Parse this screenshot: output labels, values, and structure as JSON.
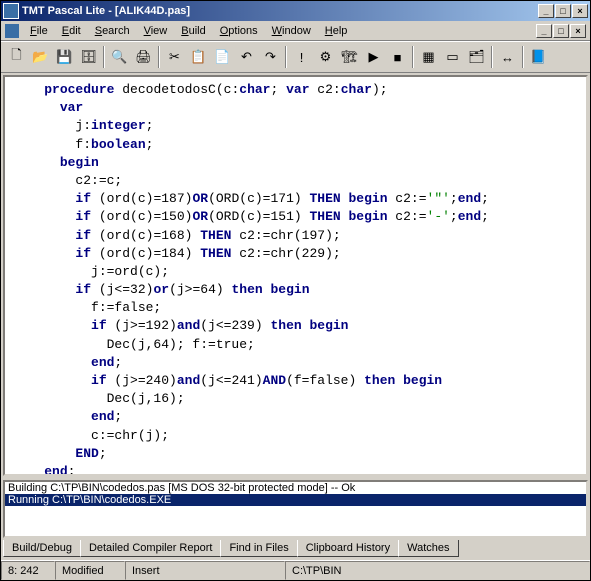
{
  "title": "TMT Pascal Lite - [ALIK44D.pas]",
  "menu": [
    "File",
    "Edit",
    "Search",
    "View",
    "Build",
    "Options",
    "Window",
    "Help"
  ],
  "winbtns": {
    "min": "_",
    "max": "□",
    "close": "×"
  },
  "toolbar_names": [
    "new-file-icon",
    "open-file-icon",
    "save-icon",
    "save-all-icon",
    "print-preview-icon",
    "print-icon",
    "cut-icon",
    "copy-icon",
    "paste-icon",
    "undo-icon",
    "redo-icon",
    "exclaim-icon",
    "compile-icon",
    "build-icon",
    "run-icon",
    "stop-icon",
    "tile-icon",
    "cascade-icon",
    "close-all-icon",
    "toggle-icon",
    "help-icon"
  ],
  "code": [
    [
      [
        "kw",
        "procedure"
      ],
      [
        "",
        ". decodetodosC(c:"
      ],
      [
        "kw",
        "char"
      ],
      [
        "",
        "; "
      ],
      [
        "kw",
        "var"
      ],
      [
        "",
        ". c2:"
      ],
      [
        "kw",
        "char"
      ],
      [
        "",
        ");"
      ]
    ],
    [
      [
        "",
        "  "
      ],
      [
        "kw",
        "var"
      ]
    ],
    [
      [
        "",
        "    j:"
      ],
      [
        "kw",
        "integer"
      ],
      [
        "",
        ";"
      ]
    ],
    [
      [
        "",
        "    f:"
      ],
      [
        "kw",
        "boolean"
      ],
      [
        "",
        ";"
      ]
    ],
    [
      [
        "",
        "  "
      ],
      [
        "kw",
        "begin"
      ]
    ],
    [
      [
        "",
        "    c2:=c;"
      ]
    ],
    [
      [
        "",
        "    "
      ],
      [
        "kw",
        "if"
      ],
      [
        "",
        " (ord(c)=187)"
      ],
      [
        "kw",
        "OR"
      ],
      [
        "",
        "(ORD(c)=171) "
      ],
      [
        "kw",
        "THEN begin"
      ],
      [
        "",
        " c2:="
      ],
      [
        "str",
        "'\"'"
      ],
      [
        "",
        ";"
      ],
      [
        "kw",
        "end"
      ],
      [
        "",
        ";"
      ]
    ],
    [
      [
        "",
        "    "
      ],
      [
        "kw",
        "if"
      ],
      [
        "",
        " (ord(c)=150)"
      ],
      [
        "kw",
        "OR"
      ],
      [
        "",
        "(ORD(c)=151) "
      ],
      [
        "kw",
        "THEN begin"
      ],
      [
        "",
        " c2:="
      ],
      [
        "str",
        "'-'"
      ],
      [
        "",
        ";"
      ],
      [
        "kw",
        "end"
      ],
      [
        "",
        ";"
      ]
    ],
    [
      [
        "",
        "    "
      ],
      [
        "kw",
        "if"
      ],
      [
        "",
        " (ord(c)=168) "
      ],
      [
        "kw",
        "THEN"
      ],
      [
        "",
        " c2:=chr(197);"
      ]
    ],
    [
      [
        "",
        "    "
      ],
      [
        "kw",
        "if"
      ],
      [
        "",
        " (ord(c)=184) "
      ],
      [
        "kw",
        "THEN"
      ],
      [
        "",
        " c2:=chr(229);"
      ]
    ],
    [
      [
        "",
        "      j:=ord(c);"
      ]
    ],
    [
      [
        "",
        "    "
      ],
      [
        "kw",
        "if"
      ],
      [
        "",
        " (j<=32)"
      ],
      [
        "kw",
        "or"
      ],
      [
        "",
        "(j>=64) "
      ],
      [
        "kw",
        "then begin"
      ]
    ],
    [
      [
        "",
        "      f:=false;"
      ]
    ],
    [
      [
        "",
        "      "
      ],
      [
        "kw",
        "if"
      ],
      [
        "",
        " (j>=192)"
      ],
      [
        "kw",
        "and"
      ],
      [
        "",
        "(j<=239) "
      ],
      [
        "kw",
        "then begin"
      ]
    ],
    [
      [
        "",
        "        Dec(j,64); f:=true;"
      ]
    ],
    [
      [
        "",
        "      "
      ],
      [
        "kw",
        "end"
      ],
      [
        "",
        ";"
      ]
    ],
    [
      [
        "",
        "      "
      ],
      [
        "kw",
        "if"
      ],
      [
        "",
        " (j>=240)"
      ],
      [
        "kw",
        "and"
      ],
      [
        "",
        "(j<=241)"
      ],
      [
        "kw",
        "AND"
      ],
      [
        "",
        "(f=false) "
      ],
      [
        "kw",
        "then begin"
      ]
    ],
    [
      [
        "",
        "        Dec(j,16);"
      ]
    ],
    [
      [
        "",
        "      "
      ],
      [
        "kw",
        "end"
      ],
      [
        "",
        ";"
      ]
    ],
    [
      [
        "",
        "      c:=chr(j);"
      ]
    ],
    [
      [
        "",
        "    "
      ],
      [
        "kw",
        "END"
      ],
      [
        "",
        ";"
      ]
    ],
    [
      [
        "kw",
        "end"
      ],
      [
        "",
        ";"
      ]
    ]
  ],
  "output": [
    {
      "t": "Building C:\\TP\\BIN\\codedos.pas  [MS DOS 32-bit protected mode] -- Ok",
      "sel": false
    },
    {
      "t": "Running C:\\TP\\BIN\\codedos.EXE",
      "sel": true
    }
  ],
  "tabs": [
    "Build/Debug",
    "Detailed Compiler Report",
    "Find in Files",
    "Clipboard History",
    "Watches"
  ],
  "status": {
    "pos": "8: 242",
    "mod": "Modified",
    "ins": "Insert",
    "path": "C:\\TP\\BIN"
  }
}
